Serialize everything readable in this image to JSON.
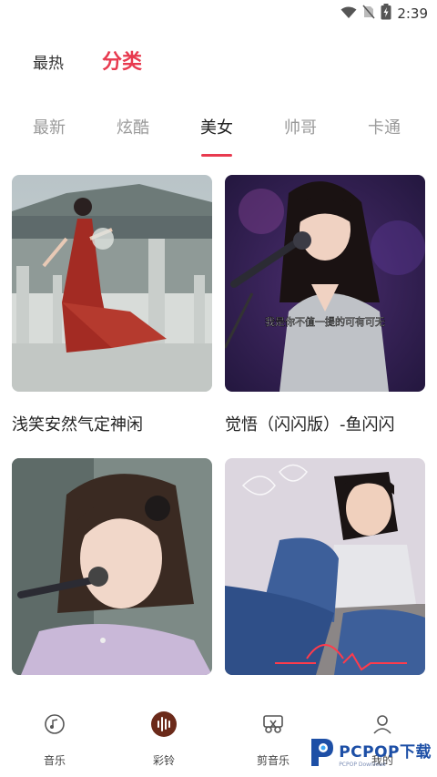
{
  "status_bar": {
    "time": "2:39"
  },
  "top_tabs": [
    {
      "label": "最热",
      "active": false
    },
    {
      "label": "分类",
      "active": true
    }
  ],
  "category_tabs": [
    {
      "label": "最新",
      "active": false
    },
    {
      "label": "炫酷",
      "active": false
    },
    {
      "label": "美女",
      "active": true
    },
    {
      "label": "帅哥",
      "active": false
    },
    {
      "label": "卡通",
      "active": false
    }
  ],
  "cards": [
    {
      "title": "浅笑安然气定神闲"
    },
    {
      "title": "觉悟（闪闪版）-鱼闪闪",
      "caption": "我是你不值一提的可有可无"
    },
    {
      "title": ""
    },
    {
      "title": ""
    }
  ],
  "bottom_nav": [
    {
      "label": "音乐",
      "icon": "music-disc-icon"
    },
    {
      "label": "彩铃",
      "icon": "waveform-icon",
      "active": true
    },
    {
      "label": "剪音乐",
      "icon": "scissors-icon"
    },
    {
      "label": "我的",
      "icon": "user-icon"
    }
  ],
  "watermark": {
    "text": "PCPOP下载",
    "sub": "PCPOP Download"
  },
  "colors": {
    "accent": "#e83a4f",
    "nav_active": "#6b2a1a"
  }
}
